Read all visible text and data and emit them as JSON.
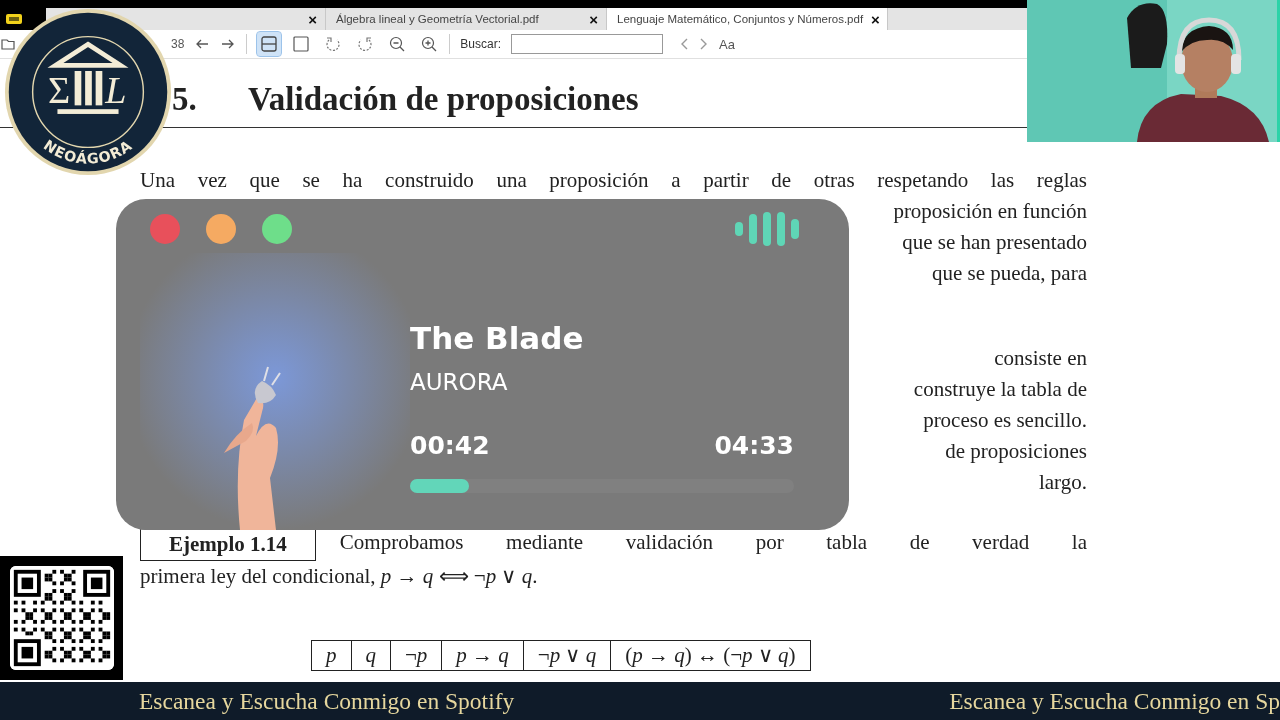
{
  "logo": {
    "left": "Σ",
    "right": "L",
    "name": "NEOÁGORA"
  },
  "tabs": [
    {
      "selected": false,
      "close": "×"
    },
    {
      "label": "Álgebra lineal y Geometría Vectorial.pdf",
      "selected": false,
      "close": "×"
    },
    {
      "label": "Lenguaje Matemático, Conjuntos y Números.pdf",
      "selected": true,
      "close": "×"
    }
  ],
  "toolbar": {
    "page_total": "38",
    "view_tools": [
      {
        "kind": "fit-width",
        "selected": true
      },
      {
        "kind": "single-page",
        "selected": false
      },
      {
        "kind": "rotate-left",
        "selected": false
      },
      {
        "kind": "rotate-right",
        "selected": false
      },
      {
        "kind": "zoom-out",
        "selected": false
      },
      {
        "kind": "zoom-in",
        "selected": false
      }
    ],
    "search_label": "Buscar:",
    "text_size": "Aa"
  },
  "document": {
    "section_number": "5.",
    "section_title": "Validación de proposiciones",
    "paragraphs": [
      {
        "lines": [
          "Una vez que se ha construido una proposición a partir de otras respetando las reglas",
          "proposición en función",
          "que se han presentado",
          "que se pueda, para"
        ]
      },
      {
        "lines": [
          "consiste en",
          "construye la tabla de",
          "proceso es sencillo.",
          "de proposiciones",
          "largo."
        ]
      }
    ],
    "example": {
      "label": "Ejemplo 1.14",
      "lines": [
        "Comprobamos mediante validación por tabla de verdad la",
        "primera ley del condicional, *p* → *q* ⟺ ¬*p* ∨ *q*."
      ]
    },
    "table_header": [
      "*p*",
      "*q*",
      "¬*p*",
      "*p* → *q*",
      "¬*p* ∨ *q*",
      "(*p* → *q*) ↔ (¬*p* ∨ *q*)"
    ]
  },
  "player": {
    "window_buttons": [
      {
        "color": "#e8505b"
      },
      {
        "color": "#f5aa62"
      },
      {
        "color": "#6ede8a"
      }
    ],
    "title": "The Blade",
    "artist": "AURORA",
    "elapsed": "00:42",
    "duration": "04:33",
    "level": 0.154
  },
  "ticker": [
    "Escanea y Escucha Conmigo en Spotify",
    "Escanea y Escucha Conmigo en Sp"
  ]
}
